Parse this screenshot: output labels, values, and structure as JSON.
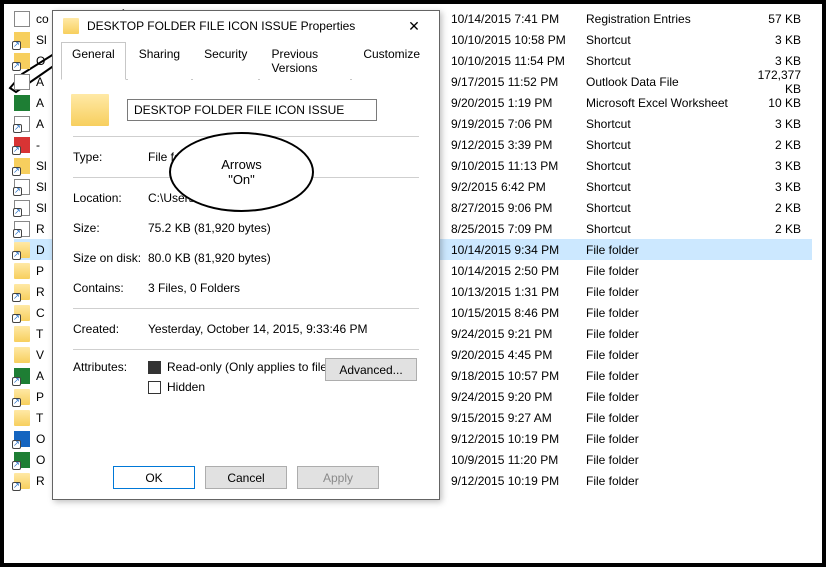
{
  "dialog": {
    "title": "DESKTOP FOLDER FILE ICON ISSUE Properties",
    "tabs": [
      "General",
      "Sharing",
      "Security",
      "Previous Versions",
      "Customize"
    ],
    "active_tab": 0,
    "name_value": "DESKTOP FOLDER FILE ICON ISSUE",
    "rows": {
      "type_label": "Type:",
      "type_value": "File folder",
      "location_label": "Location:",
      "location_value": "C:\\Users\\...\\Desktop",
      "size_label": "Size:",
      "size_value": "75.2 KB (81,920 bytes)",
      "sizeondisk_label": "Size on disk:",
      "sizeondisk_value": "80.0 KB (81,920 bytes)",
      "contains_label": "Contains:",
      "contains_value": "3 Files, 0 Folders",
      "created_label": "Created:",
      "created_value": "Yesterday, October 14, 2015, 9:33:46 PM",
      "attributes_label": "Attributes:",
      "readonly_label": "Read-only (Only applies to files in folder)",
      "hidden_label": "Hidden",
      "advanced_label": "Advanced...",
      "ok": "OK",
      "cancel": "Cancel",
      "apply": "Apply"
    }
  },
  "callout": {
    "line1": "Arrows",
    "line2": "\"On\""
  },
  "files": [
    {
      "icon": "doc",
      "name": "co",
      "date": "10/14/2015 7:41 PM",
      "type": "Registration Entries",
      "size": "57 KB",
      "arrow": false,
      "selected": false,
      "pm_visible": "PM"
    },
    {
      "icon": "yellow",
      "name": "Sl",
      "date": "10/10/2015 10:58 PM",
      "type": "Shortcut",
      "size": "3 KB",
      "arrow": true,
      "selected": false,
      "pm_visible": "PM"
    },
    {
      "icon": "yellow",
      "name": "O",
      "date": "10/10/2015 11:54 PM",
      "type": "Shortcut",
      "size": "3 KB",
      "arrow": true,
      "selected": false,
      "pm_visible": "PM"
    },
    {
      "icon": "doc",
      "name": "A",
      "date": "9/17/2015 11:52 PM",
      "type": "Outlook Data File",
      "size": "172,377 KB",
      "arrow": false,
      "selected": false,
      "pm_visible": ""
    },
    {
      "icon": "xls",
      "name": "A",
      "date": "9/20/2015 1:19 PM",
      "type": "Microsoft Excel Worksheet",
      "size": "10 KB",
      "arrow": false,
      "selected": false,
      "pm_visible": ""
    },
    {
      "icon": "doc",
      "name": "A",
      "date": "9/19/2015 7:06 PM",
      "type": "Shortcut",
      "size": "3 KB",
      "arrow": true,
      "selected": false,
      "pm_visible": ""
    },
    {
      "icon": "red",
      "name": "-",
      "date": "9/12/2015 3:39 PM",
      "type": "Shortcut",
      "size": "2 KB",
      "arrow": true,
      "selected": false,
      "pm_visible": ""
    },
    {
      "icon": "yellow",
      "name": "Sl",
      "date": "9/10/2015 11:13 PM",
      "type": "Shortcut",
      "size": "3 KB",
      "arrow": true,
      "selected": false,
      "pm_visible": ""
    },
    {
      "icon": "doc",
      "name": "Sl",
      "date": "9/2/2015 6:42 PM",
      "type": "Shortcut",
      "size": "3 KB",
      "arrow": true,
      "selected": false,
      "pm_visible": ""
    },
    {
      "icon": "doc",
      "name": "Sl",
      "date": "8/27/2015 9:06 PM",
      "type": "Shortcut",
      "size": "2 KB",
      "arrow": true,
      "selected": false,
      "pm_visible": ""
    },
    {
      "icon": "doc",
      "name": "R",
      "date": "8/25/2015 7:09 PM",
      "type": "Shortcut",
      "size": "2 KB",
      "arrow": true,
      "selected": false,
      "pm_visible": ""
    },
    {
      "icon": "folder",
      "name": "D",
      "date": "10/14/2015 9:34 PM",
      "type": "File folder",
      "size": "",
      "arrow": true,
      "selected": true,
      "pm_visible": "PM"
    },
    {
      "icon": "folder",
      "name": "P",
      "date": "10/14/2015 2:50 PM",
      "type": "File folder",
      "size": "",
      "arrow": false,
      "selected": false,
      "pm_visible": ""
    },
    {
      "icon": "folder",
      "name": "R",
      "date": "10/13/2015 1:31 PM",
      "type": "File folder",
      "size": "",
      "arrow": true,
      "selected": false,
      "pm_visible": ""
    },
    {
      "icon": "folder",
      "name": "C",
      "date": "10/15/2015 8:46 PM",
      "type": "File folder",
      "size": "",
      "arrow": true,
      "selected": false,
      "pm_visible": ""
    },
    {
      "icon": "folder",
      "name": "T",
      "date": "9/24/2015 9:21 PM",
      "type": "File folder",
      "size": "",
      "arrow": false,
      "selected": false,
      "pm_visible": ""
    },
    {
      "icon": "folder",
      "name": "V",
      "date": "9/20/2015 4:45 PM",
      "type": "File folder",
      "size": "",
      "arrow": false,
      "selected": false,
      "pm_visible": ""
    },
    {
      "icon": "green",
      "name": "A",
      "date": "9/18/2015 10:57 PM",
      "type": "File folder",
      "size": "",
      "arrow": true,
      "selected": false,
      "pm_visible": ""
    },
    {
      "icon": "folder",
      "name": "P",
      "date": "9/24/2015 9:20 PM",
      "type": "File folder",
      "size": "",
      "arrow": true,
      "selected": false,
      "pm_visible": ""
    },
    {
      "icon": "folder",
      "name": "T",
      "date": "9/15/2015 9:27 AM",
      "type": "File folder",
      "size": "",
      "arrow": false,
      "selected": false,
      "pm_visible": ""
    },
    {
      "icon": "blue",
      "name": "O",
      "date": "9/12/2015 10:19 PM",
      "type": "File folder",
      "size": "",
      "arrow": true,
      "selected": false,
      "pm_visible": ""
    },
    {
      "icon": "green",
      "name": "O",
      "date": "10/9/2015 11:20 PM",
      "type": "File folder",
      "size": "",
      "arrow": true,
      "selected": false,
      "pm_visible": ""
    },
    {
      "icon": "folder",
      "name": "R",
      "date": "9/12/2015 10:19 PM",
      "type": "File folder",
      "size": "",
      "arrow": true,
      "selected": false,
      "pm_visible": ""
    }
  ]
}
